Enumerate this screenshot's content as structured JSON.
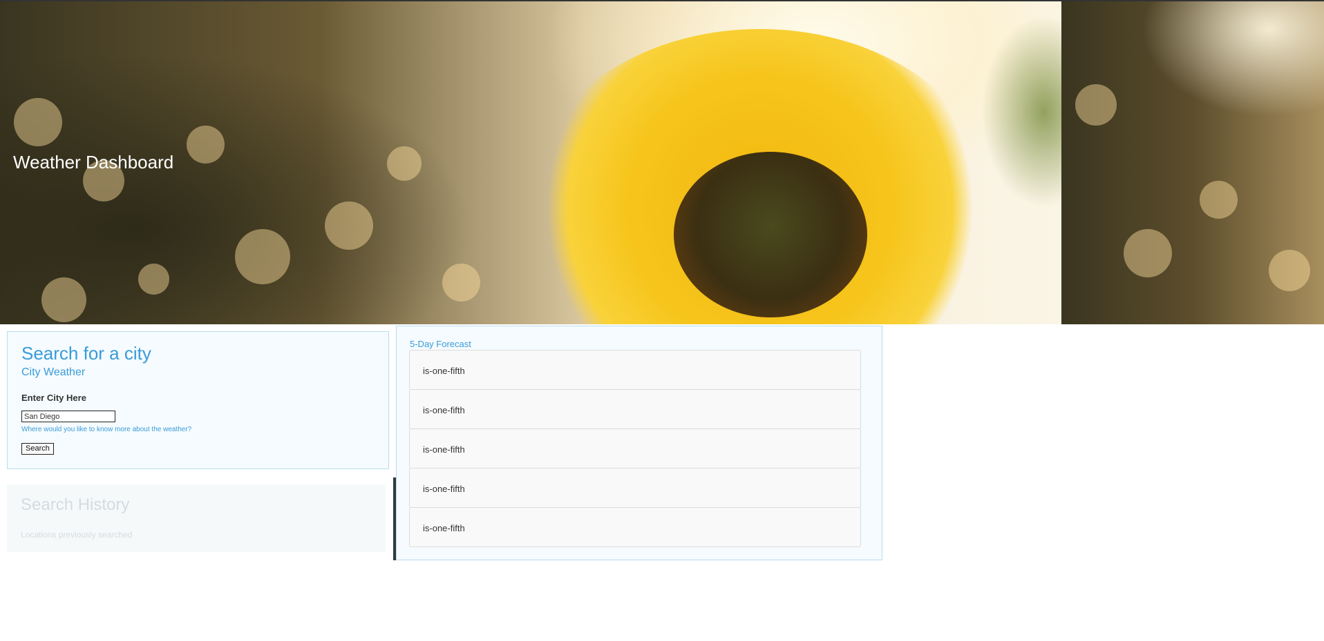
{
  "header": {
    "title": "Weather Dashboard"
  },
  "search": {
    "title": "Search for a city",
    "subtitle": "City Weather",
    "label": "Enter City Here",
    "input_value": "San Diego",
    "help_text": "Where would you like to know more about the weather?",
    "button_label": "Search"
  },
  "history": {
    "title": "Search History",
    "subtitle": "Locations previously searched"
  },
  "forecast": {
    "title": "5-Day Forecast",
    "items": [
      "is-one-fifth",
      "is-one-fifth",
      "is-one-fifth",
      "is-one-fifth",
      "is-one-fifth"
    ]
  },
  "colors": {
    "accent": "#3a9bd8",
    "panel_border": "#b9dcef",
    "panel_bg": "#f5fbfe",
    "divider": "#2e3a3f"
  }
}
